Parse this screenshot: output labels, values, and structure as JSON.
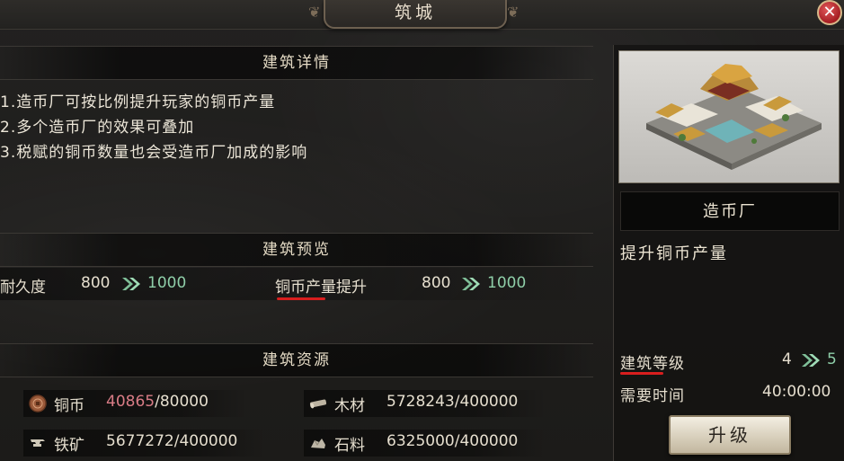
{
  "window": {
    "title": "筑城",
    "close_label": "✕"
  },
  "details": {
    "header": "建筑详情",
    "lines": [
      "1.造币厂可按比例提升玩家的铜币产量",
      "2.多个造币厂的效果可叠加",
      "3.税赋的铜币数量也会受造币厂加成的影响"
    ]
  },
  "preview": {
    "header": "建筑预览",
    "durability": {
      "label": "耐久度",
      "current": "800",
      "next": "1000"
    },
    "copper_boost": {
      "label": "铜币产量提升",
      "current": "800",
      "next": "1000"
    }
  },
  "resources": {
    "header": "建筑资源",
    "copper": {
      "label": "铜币",
      "current": "40865",
      "required": "/80000",
      "icon": "copper-coin-icon"
    },
    "wood": {
      "label": "木材",
      "value": "5728243/400000",
      "icon": "wood-icon"
    },
    "iron": {
      "label": "铁矿",
      "value": "5677272/400000",
      "icon": "iron-anvil-icon"
    },
    "stone": {
      "label": "石料",
      "value": "6325000/400000",
      "icon": "stone-icon"
    }
  },
  "building": {
    "name": "造币厂",
    "effect": "提升铜币产量",
    "level_label": "建筑等级",
    "level_current": "4",
    "level_next": "5",
    "time_label": "需要时间",
    "time_value": "40:00:00",
    "upgrade_label": "升级"
  },
  "colors": {
    "accent_green": "#8fcfa9",
    "insufficient_red": "#d97c86",
    "highlight_underline": "#d81e1e",
    "close_red": "#b8262b"
  }
}
